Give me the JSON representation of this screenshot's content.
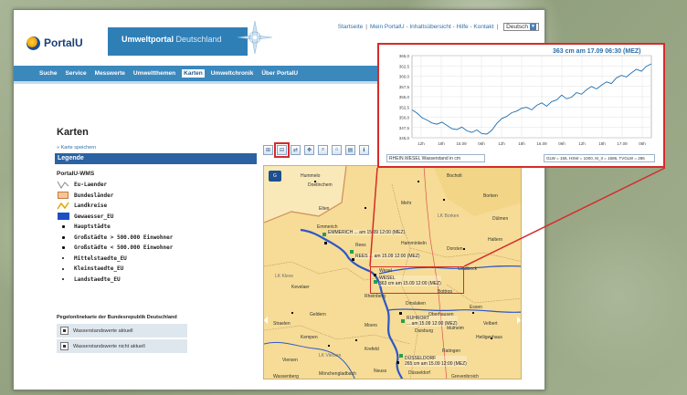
{
  "header": {
    "logo_text": "PortalU",
    "portal_name": "Umweltportal",
    "portal_country": "Deutschland",
    "topnav": [
      "Startseite",
      "Mein PortalU - Inhaltsübersicht - Hilfe - Kontakt",
      "Deutsch"
    ],
    "topnav_sep": "|"
  },
  "nav": {
    "items": [
      {
        "label": "Suche",
        "active": false
      },
      {
        "label": "Service",
        "active": false
      },
      {
        "label": "Messwerte",
        "active": false
      },
      {
        "label": "Umweltthemen",
        "active": false
      },
      {
        "label": "Karten",
        "active": true
      },
      {
        "label": "Umweltchronik",
        "active": false
      },
      {
        "label": "Über PortalU",
        "active": false
      }
    ]
  },
  "content": {
    "page_title": "Karten",
    "save_link": "» Karte speichern",
    "legend_header": "Legende",
    "legend_group": "PortalU-WMS",
    "legend_items": [
      {
        "label": "Eu-Laender",
        "symbol": "line-icon"
      },
      {
        "label": "Bundesländer",
        "symbol": "box-icon"
      },
      {
        "label": "Landkreise",
        "symbol": "yellow-line-icon"
      },
      {
        "label": "Gewaesser_EU",
        "symbol": "blue-box-icon"
      },
      {
        "label": "Hauptstädte",
        "symbol": "dot-icon"
      },
      {
        "label": "Großstädte > 500.000 Einwohner",
        "symbol": "dot-icon"
      },
      {
        "label": "Großstädte < 500.000 Einwohner",
        "symbol": "dot-icon"
      },
      {
        "label": "Mittelstaedte_EU",
        "symbol": "small-dot-icon"
      },
      {
        "label": "Kleinstaedte_EU",
        "symbol": "small-dot-icon"
      },
      {
        "label": "Landstaedte_EU",
        "symbol": "small-dot-icon"
      }
    ],
    "pegel_title": "Pegelonlinekarte der Bundesrepublik Deutschland",
    "wasser_rows": [
      "Wasserstandswerte aktuell",
      "Wasserstandswerte nicht aktuell"
    ]
  },
  "toolbar": {
    "buttons": [
      "⊞",
      "⊟",
      "⇄",
      "✥",
      "⌕",
      "⌂",
      "▤",
      "ℹ"
    ]
  },
  "map": {
    "globe_label": "G",
    "cities": [
      {
        "name": "Hummelo"
      },
      {
        "name": "Doetinchem"
      },
      {
        "name": "Elten"
      },
      {
        "name": "Emmerich"
      },
      {
        "name": "Rees"
      },
      {
        "name": "Mehr"
      },
      {
        "name": "Bocholt"
      },
      {
        "name": "Hamminkeln"
      },
      {
        "name": "Wesel"
      },
      {
        "name": "Rheinberg"
      },
      {
        "name": "Dinslaken"
      },
      {
        "name": "Moers"
      },
      {
        "name": "Duisburg"
      },
      {
        "name": "Krefeld"
      },
      {
        "name": "Kempen"
      },
      {
        "name": "Viersen"
      },
      {
        "name": "Neuss"
      },
      {
        "name": "Düsseldorf"
      },
      {
        "name": "Mönchengladbach"
      },
      {
        "name": "Grevenbroich"
      },
      {
        "name": "Kevelaer"
      },
      {
        "name": "Geldern"
      },
      {
        "name": "Straelen"
      },
      {
        "name": "Borken"
      },
      {
        "name": "Dorsten"
      },
      {
        "name": "Haltern"
      },
      {
        "name": "Dülmen"
      },
      {
        "name": "Gladbeck"
      },
      {
        "name": "Bottrop"
      },
      {
        "name": "Oberhausen"
      },
      {
        "name": "Essen"
      },
      {
        "name": "Mülheim"
      },
      {
        "name": "Velbert"
      },
      {
        "name": "Ratingen"
      },
      {
        "name": "Heiligenhaus"
      },
      {
        "name": "Wassenberg"
      }
    ],
    "regions": [
      "LK Kleve",
      "LK Borken",
      "LK Viersen"
    ],
    "gauges": [
      {
        "name": "EMMERICH",
        "text": "... am 15.09 12:00 (MEZ)"
      },
      {
        "name": "REES",
        "text": "... am 15.09 12:00 (MEZ)"
      },
      {
        "name": "WESEL",
        "text": "363 cm am 15.09 12:00 (MEZ)"
      },
      {
        "name": "RUHRORT",
        "text": "... am 15.09 12:00 (MEZ)"
      },
      {
        "name": "DÜSSELDORF",
        "text": "265 cm am 15.09 12:00 (MEZ)"
      }
    ]
  },
  "zoom": {
    "title": "363 cm am 17.09 06:30 (MEZ)",
    "footer_left": "RHEIN.WESEL Wasserstand in cm",
    "footer_right": "GLW = 155, HSW = 1000, M_II = 1686, TVGLW = 286"
  },
  "chart_data": {
    "type": "line",
    "title": "363 cm am 17.09 06:30 (MEZ)",
    "xlabel": "",
    "ylabel": "",
    "x_tick_labels": [
      "12h",
      "18h",
      "15.09",
      "06h",
      "12h",
      "18h",
      "16.09",
      "06h",
      "12h",
      "18h",
      "17.09",
      "06h"
    ],
    "y_tick_labels": [
      "345,0",
      "347,5",
      "350,0",
      "352,5",
      "355,0",
      "357,5",
      "360,0",
      "362,5",
      "365,0"
    ],
    "ylim": [
      345,
      365
    ],
    "grid": true,
    "series": [
      {
        "values": [
          351.8,
          351.0,
          349.9,
          349.3,
          348.6,
          348.3,
          348.8,
          348.0,
          347.2,
          347.0,
          347.6,
          346.7,
          346.3,
          346.9,
          346.0,
          345.9,
          346.8,
          348.5,
          349.7,
          350.2,
          351.1,
          351.5,
          352.2,
          352.4,
          351.8,
          352.9,
          353.5,
          352.7,
          353.8,
          354.2,
          355.4,
          354.5,
          354.9,
          356.0,
          355.6,
          356.7,
          357.5,
          356.9,
          357.8,
          358.6,
          358.2,
          359.6,
          360.2,
          359.8,
          360.8,
          361.7,
          361.2,
          362.4,
          363.0
        ]
      }
    ]
  }
}
